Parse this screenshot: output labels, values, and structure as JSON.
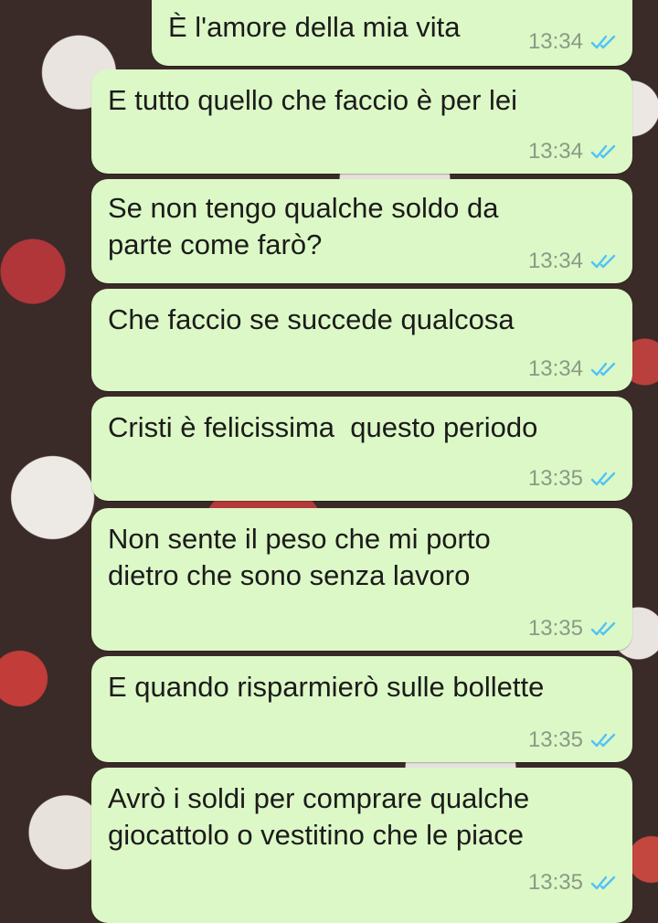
{
  "chat": {
    "messages": [
      {
        "text": "È l'amore della mia vita",
        "time": "13:34",
        "status": "read-double-check-icon"
      },
      {
        "text": "E tutto quello che faccio è per lei",
        "time": "13:34",
        "status": "read-double-check-icon"
      },
      {
        "text": "Se non tengo qualche soldo da\nparte come farò?",
        "time": "13:34",
        "status": "read-double-check-icon"
      },
      {
        "text": "Che faccio se succede qualcosa",
        "time": "13:34",
        "status": "read-double-check-icon"
      },
      {
        "text": "Cristi è felicissima  questo periodo",
        "time": "13:35",
        "status": "read-double-check-icon"
      },
      {
        "text": "Non sente il peso che mi porto\ndietro che sono senza lavoro",
        "time": "13:35",
        "status": "read-double-check-icon"
      },
      {
        "text": "E quando risparmierò sulle bollette",
        "time": "13:35",
        "status": "read-double-check-icon"
      },
      {
        "text": "Avrò i soldi per comprare qualche\ngiocattolo o vestitino che le piace",
        "time": "13:35",
        "status": "read-double-check-icon"
      }
    ]
  },
  "colors": {
    "bubble_outgoing": "#dcf8c6",
    "read_ticks": "#4fc3f7",
    "timestamp": "#8a9a86"
  }
}
